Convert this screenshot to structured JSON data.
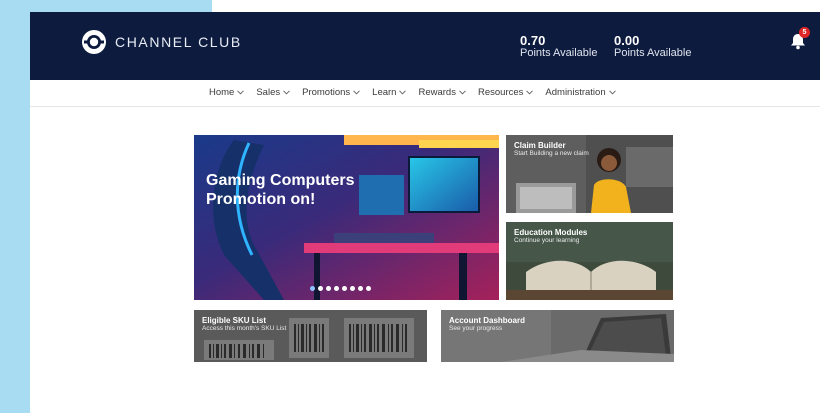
{
  "brand": {
    "name": "CHANNEL CLUB",
    "logo_icon": "channel-club-logo"
  },
  "points": [
    {
      "value": "0.70",
      "label": "Points Available"
    },
    {
      "value": "0.00",
      "label": "Points Available"
    }
  ],
  "notifications": {
    "count": "5",
    "icon": "bell-icon"
  },
  "nav": [
    {
      "label": "Home"
    },
    {
      "label": "Sales"
    },
    {
      "label": "Promotions"
    },
    {
      "label": "Learn"
    },
    {
      "label": "Rewards"
    },
    {
      "label": "Resources"
    },
    {
      "label": "Administration"
    }
  ],
  "hero": {
    "line1": "Gaming Computers",
    "line2": "Promotion on!",
    "slide_count": 8,
    "active_slide": 1
  },
  "tiles": {
    "claim": {
      "title": "Claim Builder",
      "subtitle": "Start Building a new claim"
    },
    "edu": {
      "title": "Education Modules",
      "subtitle": "Continue your learning"
    },
    "sku": {
      "title": "Eligible SKU List",
      "subtitle": "Access this month's SKU List"
    },
    "acct": {
      "title": "Account Dashboard",
      "subtitle": "See your progress"
    }
  },
  "colors": {
    "header_bg": "#0d1b3e",
    "page_side_bg": "#a8dcf3",
    "badge": "#e02727"
  }
}
